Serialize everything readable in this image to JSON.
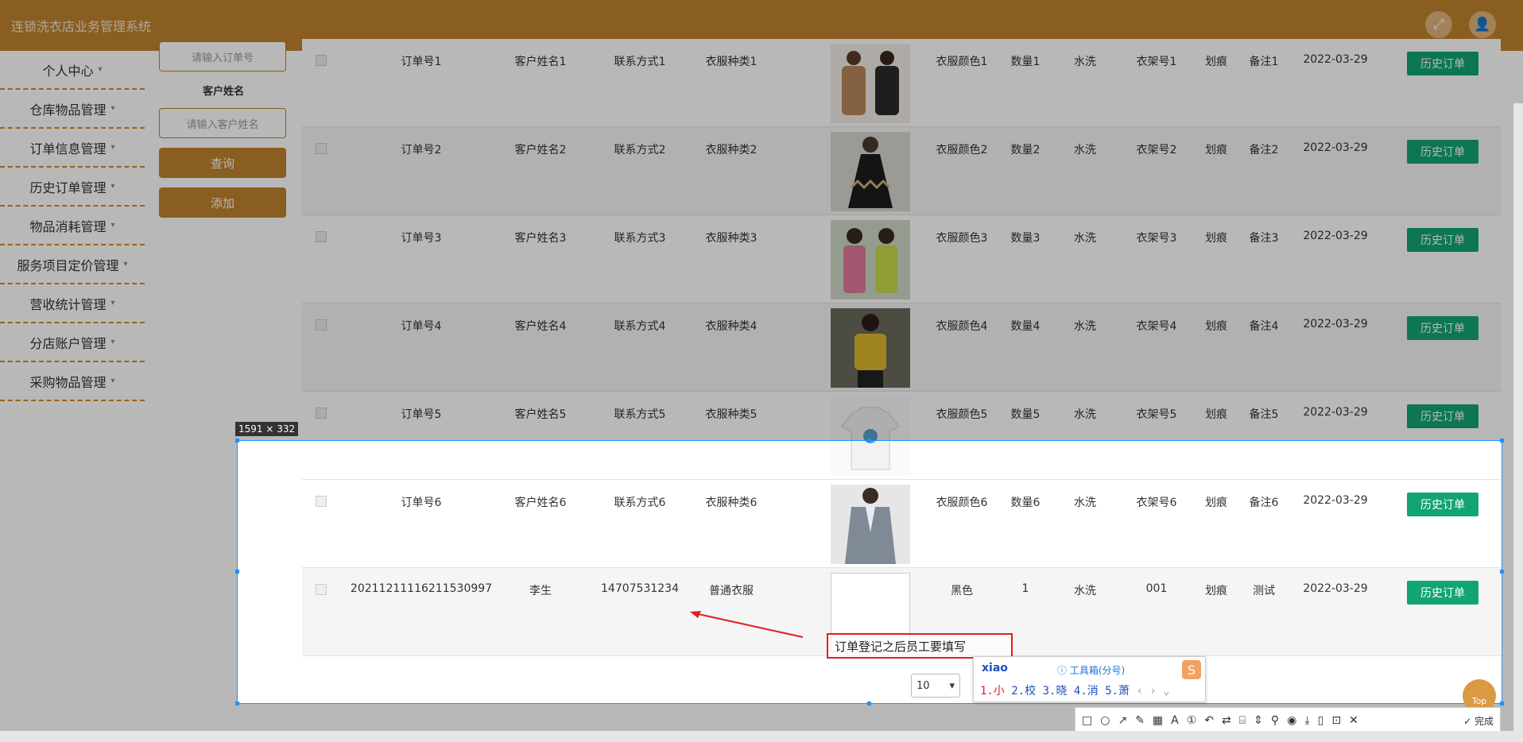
{
  "app": {
    "title": "连锁洗衣店业务管理系统",
    "expand_icon": "⤢",
    "user_icon": "👤"
  },
  "sidebar": {
    "items": [
      {
        "label": "个人中心"
      },
      {
        "label": "仓库物品管理"
      },
      {
        "label": "订单信息管理"
      },
      {
        "label": "历史订单管理"
      },
      {
        "label": "物品消耗管理"
      },
      {
        "label": "服务项目定价管理"
      },
      {
        "label": "营收统计管理"
      },
      {
        "label": "分店账户管理"
      },
      {
        "label": "采购物品管理"
      }
    ]
  },
  "filter": {
    "order_placeholder": "请输入订单号",
    "customer_label": "客户姓名",
    "customer_placeholder": "请输入客户姓名",
    "query_label": "查询",
    "add_label": "添加"
  },
  "table": {
    "rows": [
      {
        "order": "订单号1",
        "name": "客户姓名1",
        "contact": "联系方式1",
        "type": "衣服种类1",
        "color": "衣服颜色1",
        "qty": "数量1",
        "wash": "水洗",
        "rack": "衣架号1",
        "mark": "划痕",
        "note": "备注1",
        "date": "2022-03-29",
        "btn": "历史订单"
      },
      {
        "order": "订单号2",
        "name": "客户姓名2",
        "contact": "联系方式2",
        "type": "衣服种类2",
        "color": "衣服颜色2",
        "qty": "数量2",
        "wash": "水洗",
        "rack": "衣架号2",
        "mark": "划痕",
        "note": "备注2",
        "date": "2022-03-29",
        "btn": "历史订单"
      },
      {
        "order": "订单号3",
        "name": "客户姓名3",
        "contact": "联系方式3",
        "type": "衣服种类3",
        "color": "衣服颜色3",
        "qty": "数量3",
        "wash": "水洗",
        "rack": "衣架号3",
        "mark": "划痕",
        "note": "备注3",
        "date": "2022-03-29",
        "btn": "历史订单"
      },
      {
        "order": "订单号4",
        "name": "客户姓名4",
        "contact": "联系方式4",
        "type": "衣服种类4",
        "color": "衣服颜色4",
        "qty": "数量4",
        "wash": "水洗",
        "rack": "衣架号4",
        "mark": "划痕",
        "note": "备注4",
        "date": "2022-03-29",
        "btn": "历史订单"
      },
      {
        "order": "订单号5",
        "name": "客户姓名5",
        "contact": "联系方式5",
        "type": "衣服种类5",
        "color": "衣服颜色5",
        "qty": "数量5",
        "wash": "水洗",
        "rack": "衣架号5",
        "mark": "划痕",
        "note": "备注5",
        "date": "2022-03-29",
        "btn": "历史订单"
      },
      {
        "order": "订单号6",
        "name": "客户姓名6",
        "contact": "联系方式6",
        "type": "衣服种类6",
        "color": "衣服颜色6",
        "qty": "数量6",
        "wash": "水洗",
        "rack": "衣架号6",
        "mark": "划痕",
        "note": "备注6",
        "date": "2022-03-29",
        "btn": "历史订单"
      },
      {
        "order": "20211211116211530997",
        "name": "李生",
        "contact": "14707531234",
        "type": "普通衣服",
        "color": "黑色",
        "qty": "1",
        "wash": "水洗",
        "rack": "001",
        "mark": "划痕",
        "note": "测试",
        "date": "2022-03-29",
        "btn": "历史订单"
      }
    ]
  },
  "screenshot_tool": {
    "size_label": "1591 × 332",
    "annotation_text": "订单登记之后员工要填写",
    "done_label": "完成"
  },
  "pager": {
    "page_size": "10",
    "caret": "▾"
  },
  "ime": {
    "pinyin": "xiao",
    "toolbox": "ⓘ 工具箱(分号)",
    "c1": "1.小",
    "c2": "2.校",
    "c3": "3.晓",
    "c4": "4.消",
    "c5": "5.萧",
    "nav": "‹ › ⌄"
  },
  "top_button": "Top",
  "colors": {
    "brand": "#c0822f",
    "history_btn": "#12a573",
    "annotation": "#e02020",
    "selection": "#1e90ff"
  }
}
